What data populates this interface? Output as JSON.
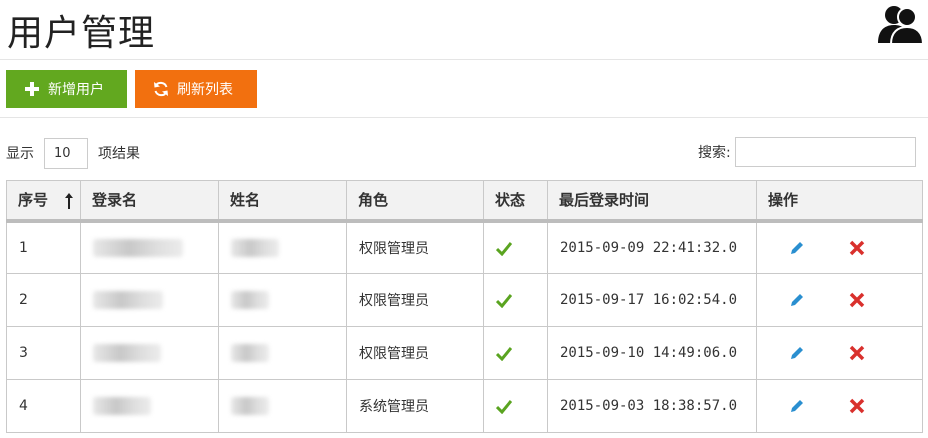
{
  "page": {
    "title": "用户管理",
    "logo_icon": "users-icon"
  },
  "toolbar": {
    "add_label": "新增用户",
    "add_icon": "plus-icon",
    "add_color": "#62a81f",
    "refresh_label": "刷新列表",
    "refresh_icon": "refresh-icon",
    "refresh_color": "#f2700f"
  },
  "length": {
    "prefix": "显示",
    "value": "10",
    "suffix": "项结果"
  },
  "search": {
    "label": "搜索:",
    "value": ""
  },
  "table": {
    "columns": [
      "序号",
      "登录名",
      "姓名",
      "角色",
      "状态",
      "最后登录时间",
      "操作"
    ],
    "sort_icon": "sort-asc-icon",
    "rows": [
      {
        "index": "1",
        "role": "权限管理员",
        "status": "active",
        "last_login": "2015-09-09 22:41:32.0"
      },
      {
        "index": "2",
        "role": "权限管理员",
        "status": "active",
        "last_login": "2015-09-17 16:02:54.0"
      },
      {
        "index": "3",
        "role": "权限管理员",
        "status": "active",
        "last_login": "2015-09-10 14:49:06.0"
      },
      {
        "index": "4",
        "role": "系统管理员",
        "status": "active",
        "last_login": "2015-09-03 18:38:57.0"
      }
    ]
  },
  "colors": {
    "check": "#5aa420",
    "edit": "#2a8fd0",
    "delete": "#d9302c"
  }
}
